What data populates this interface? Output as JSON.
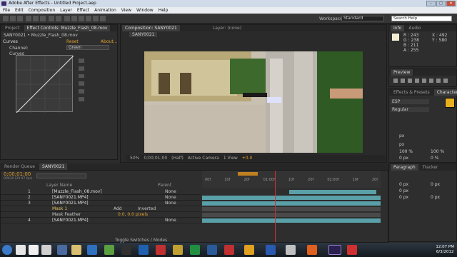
{
  "title": "Adobe After Effects - Untitled Project.aep",
  "window_buttons": [
    "–",
    "□",
    "✕"
  ],
  "menu": [
    "File",
    "Edit",
    "Composition",
    "Layer",
    "Effect",
    "Animation",
    "View",
    "Window",
    "Help"
  ],
  "workspace": {
    "label": "Workspace:",
    "value": "Standard"
  },
  "search_help": "Search Help",
  "left_panel": {
    "tabs": [
      "Project",
      "Effect Controls: Muzzle_Flash_08.mov"
    ],
    "breadcrumb": "SANY0021 • Muzzle_Flash_08.mov",
    "effect": "Curves",
    "reset": "Reset",
    "about": "About...",
    "sub": "Curves",
    "channel_label": "Channel:",
    "channel_value": "Green"
  },
  "comp_panel": {
    "tab": "Composition: SANY0021",
    "layer_tab": "Layer: (none)",
    "subtab": "SANY0021",
    "zoom": "50%",
    "time": "0;00;01;00",
    "res": "(Half)",
    "camera": "Active Camera",
    "views": "1 View",
    "offset": "+0.0"
  },
  "timeline": {
    "tabs": [
      "Render Queue",
      "SANY0021"
    ],
    "current_time": "0;00;01;00",
    "frame_info": "00030 (29.97 fps)",
    "header_name": "Layer Name",
    "header_parent": "Parent",
    "ruler": [
      "00f",
      "10f",
      "20f",
      "01:00f",
      "10f",
      "20f",
      "02:00f",
      "10f",
      "20f"
    ],
    "layers": [
      {
        "num": "1",
        "name": "[Muzzle_Flash_08.mov]",
        "parent": "None"
      },
      {
        "num": "2",
        "name": "[SANY0021.MP4]",
        "parent": "None"
      },
      {
        "num": "3",
        "name": "[SANY0021.MP4]",
        "parent": "None"
      },
      {
        "num": "",
        "name": "Mask 1",
        "mode": "Add",
        "inverted": "Inverted"
      },
      {
        "num": "",
        "name": "Mask Feather",
        "value": "0.0, 0.0 pixels"
      },
      {
        "num": "4",
        "name": "[SANY0021.MP4]",
        "parent": "None"
      }
    ],
    "toggle": "Toggle Switches / Modes"
  },
  "info_panel": {
    "tabs": [
      "Info",
      "Audio"
    ],
    "r": "R : 243",
    "g": "G : 238",
    "b": "B : 211",
    "a": "A : 255",
    "x": "X : 492",
    "y": "Y : 580"
  },
  "preview_tab": "Preview",
  "effects_tabs": [
    "Effects & Presets",
    "Character"
  ],
  "character": {
    "font": "ESP",
    "style": "Regular",
    "px1": "px",
    "px2": "px",
    "pct1": "100 %",
    "pct2": "100 %",
    "px3": "0 px",
    "pct3": "0 %"
  },
  "paragraph_tabs": [
    "Paragraph",
    "Tracker"
  ],
  "paragraph": {
    "a": "0 px",
    "b": "0 px",
    "c": "0 px",
    "d": "0 px",
    "e": "0 px"
  },
  "clock": {
    "time": "12:07 PM",
    "date": "6/3/2012"
  },
  "colors": {
    "accent": "#e0a030",
    "track_teal": "#5aa0a8",
    "playhead": "#d03030",
    "swatch": "#e8b020"
  }
}
